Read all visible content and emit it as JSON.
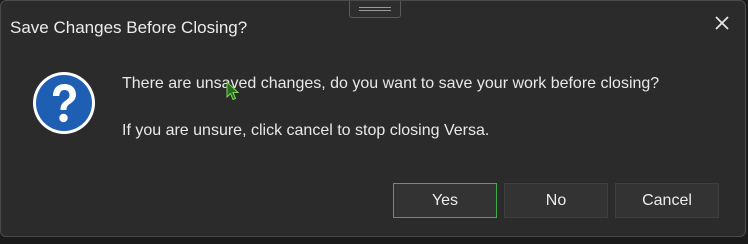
{
  "dialog": {
    "title": "Save Changes Before Closing?",
    "message_primary": "There are unsaved changes, do you want to save your work before closing?",
    "message_secondary": "If you are unsure, click cancel to stop closing Versa.",
    "icon": "question-icon",
    "close_icon": "close-icon"
  },
  "buttons": {
    "yes_label": "Yes",
    "no_label": "No",
    "cancel_label": "Cancel",
    "default": "yes"
  },
  "colors": {
    "background": "#2b2b2b",
    "text": "#e8e8e8",
    "focus_border": "#3fae4a",
    "icon_blue": "#1f5fb3"
  }
}
